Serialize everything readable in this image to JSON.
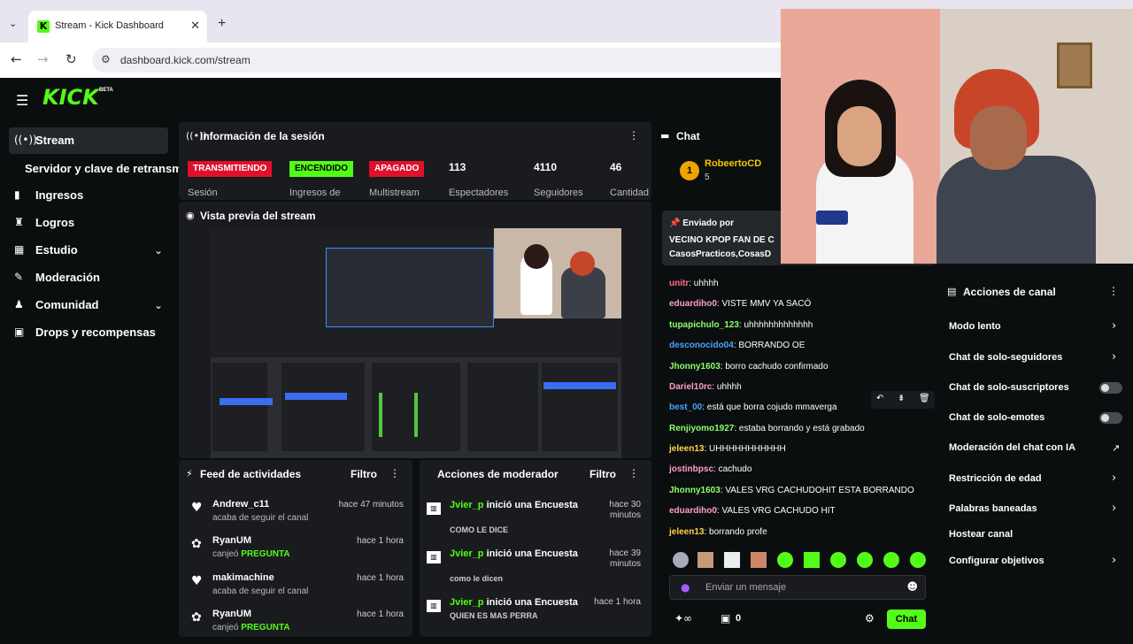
{
  "browser": {
    "tab_title": "Stream - Kick Dashboard",
    "tab_favicon": "K",
    "url": "dashboard.kick.com/stream"
  },
  "brand": {
    "logo": "KICK",
    "beta": "BETA",
    "accent": "#53fc18"
  },
  "sidebar": {
    "items": [
      {
        "label": "Stream",
        "icon": "broadcast-icon"
      },
      {
        "label": "Servidor y clave de retransm",
        "icon": ""
      },
      {
        "label": "Ingresos",
        "icon": "chart-icon"
      },
      {
        "label": "Logros",
        "icon": "trophy-icon"
      },
      {
        "label": "Estudio",
        "icon": "studio-icon"
      },
      {
        "label": "Moderación",
        "icon": "wrench-icon"
      },
      {
        "label": "Comunidad",
        "icon": "people-icon"
      },
      {
        "label": "Drops y recompensas",
        "icon": "gift-icon"
      }
    ]
  },
  "session": {
    "title": "Información de la sesión",
    "badges": [
      {
        "text": "TRANSMITIENDO",
        "label": "Sesión"
      },
      {
        "text": "ENCENDIDO",
        "label": "Ingresos de"
      },
      {
        "text": "APAGADO",
        "label": "Multistream"
      }
    ],
    "stats": [
      {
        "value": "113",
        "label": "Espectadores"
      },
      {
        "value": "4110",
        "label": "Seguidores"
      },
      {
        "value": "46",
        "label": "Cantidad"
      }
    ]
  },
  "preview": {
    "title": "Vista previa del stream"
  },
  "feed": {
    "title": "Feed de actividades",
    "filter": "Filtro",
    "items": [
      {
        "name": "Andrew_c11",
        "sub": "acaba de seguir el canal",
        "highlight": "",
        "time": "hace 47 minutos",
        "icon": "heart-icon"
      },
      {
        "name": "RyanUM",
        "sub": "canjeó",
        "highlight": "PREGUNTA",
        "time": "hace 1 hora",
        "icon": "reward-icon"
      },
      {
        "name": "makimachine",
        "sub": "acaba de seguir el canal",
        "highlight": "",
        "time": "hace 1 hora",
        "icon": "heart-icon"
      },
      {
        "name": "RyanUM",
        "sub": "canjeó",
        "highlight": "PREGUNTA",
        "time": "hace 1 hora",
        "icon": "reward-icon"
      }
    ]
  },
  "mod": {
    "title": "Acciones de moderador",
    "filter": "Filtro",
    "items": [
      {
        "user": "Jvier_p",
        "action": " inició una Encuesta",
        "sub": "COMO LE DICE",
        "time": "hace 30 minutos"
      },
      {
        "user": "Jvier_p",
        "action": " inició una Encuesta",
        "sub": "como le dicen",
        "time": "hace 39 minutos"
      },
      {
        "user": "Jvier_p",
        "action": " inició una Encuesta",
        "sub": "QUIEN ES MAS PERRA",
        "time": "hace 1 hora"
      }
    ]
  },
  "chat": {
    "title": "Chat",
    "top_user": {
      "name": "RobeertoCD",
      "rank": "1",
      "count": "5"
    },
    "pinned": {
      "by": "Enviado por",
      "line1": "VECINO KPOP FAN DE C",
      "line2": "CasosPracticos,CosasD"
    },
    "messages": [
      {
        "user": "unitr",
        "text": ": uhhhh",
        "color": "#ff6b8b"
      },
      {
        "user": "eduardiho0",
        "text": ": VISTE MMV YA SACÓ",
        "color": "#ff9ec7"
      },
      {
        "user": "tupapichulo_123",
        "text": ": uhhhhhhhhhhhhh",
        "color": "#8dff6b"
      },
      {
        "user": "desconocido04",
        "text": ": BORRANDO OE",
        "color": "#4aa3ff"
      },
      {
        "user": "Jhonny1603",
        "text": ": borro cachudo confirmado",
        "color": "#8dff6b"
      },
      {
        "user": "Dariel10rc",
        "text": ": uhhhh",
        "color": "#ff9ec7"
      },
      {
        "user": "best_00",
        "text": ": está que borra cojudo mmaverga",
        "color": "#4aa3ff"
      },
      {
        "user": "Renjiyomo1927",
        "text": ": estaba borrando y está grabado",
        "color": "#8dff6b"
      },
      {
        "user": "jeleen13",
        "text": ": UHHHHHHHHHHH",
        "color": "#ffd34a"
      },
      {
        "user": "jostinbpsc",
        "text": ": cachudo",
        "color": "#ff9ec7"
      },
      {
        "user": "Jhonny1603",
        "text": ": VALES VRG CACHUDOHIT ESTA BORRANDO",
        "color": "#8dff6b"
      },
      {
        "user": "eduardiho0",
        "text": ": VALES VRG CACHUDO HIT",
        "color": "#ff9ec7"
      },
      {
        "user": "jeleen13",
        "text": ": borrando profe",
        "color": "#ffd34a"
      }
    ],
    "input_placeholder": "Enviar un mensaje",
    "points": "0",
    "send_label": "Chat"
  },
  "actions": {
    "title": "Acciones de canal",
    "items": [
      {
        "label": "Modo lento",
        "control": "chevron"
      },
      {
        "label": "Chat de solo-seguidores",
        "control": "chevron"
      },
      {
        "label": "Chat de solo-suscriptores",
        "control": "toggle"
      },
      {
        "label": "Chat de solo-emotes",
        "control": "toggle"
      },
      {
        "label": "Moderación del chat con IA",
        "control": "external"
      },
      {
        "label": "Restricción de edad",
        "control": "chevron"
      },
      {
        "label": "Palabras baneadas",
        "control": "chevron"
      },
      {
        "label": "Hostear canal",
        "control": "none"
      },
      {
        "label": "Configurar objetivos",
        "control": "chevron"
      }
    ]
  }
}
